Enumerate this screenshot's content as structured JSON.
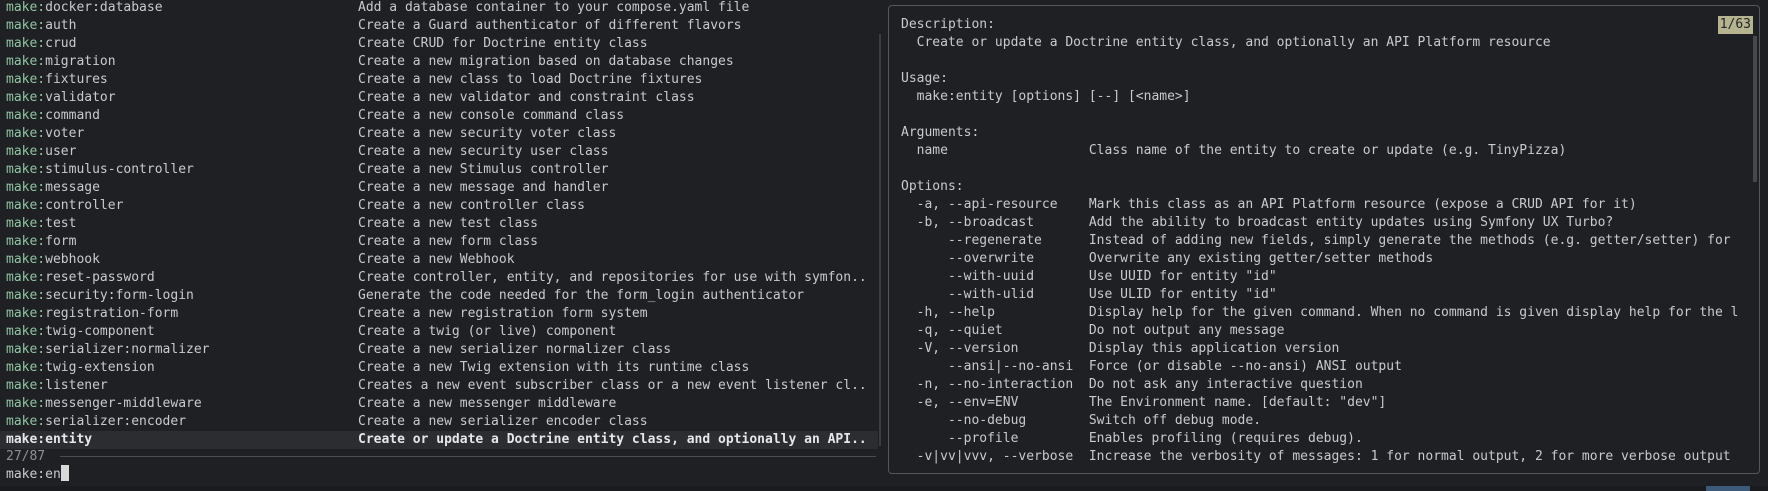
{
  "list": {
    "items": [
      {
        "cmd": "docker:database",
        "desc": "Add a database container to your compose.yaml file"
      },
      {
        "cmd": "auth",
        "desc": "Create a Guard authenticator of different flavors"
      },
      {
        "cmd": "crud",
        "desc": "Create CRUD for Doctrine entity class"
      },
      {
        "cmd": "migration",
        "desc": "Create a new migration based on database changes"
      },
      {
        "cmd": "fixtures",
        "desc": "Create a new class to load Doctrine fixtures"
      },
      {
        "cmd": "validator",
        "desc": "Create a new validator and constraint class"
      },
      {
        "cmd": "command",
        "desc": "Create a new console command class"
      },
      {
        "cmd": "voter",
        "desc": "Create a new security voter class"
      },
      {
        "cmd": "user",
        "desc": "Create a new security user class"
      },
      {
        "cmd": "stimulus-controller",
        "desc": "Create a new Stimulus controller"
      },
      {
        "cmd": "message",
        "desc": "Create a new message and handler"
      },
      {
        "cmd": "controller",
        "desc": "Create a new controller class"
      },
      {
        "cmd": "test",
        "desc": "Create a new test class"
      },
      {
        "cmd": "form",
        "desc": "Create a new form class"
      },
      {
        "cmd": "webhook",
        "desc": "Create a new Webhook"
      },
      {
        "cmd": "reset-password",
        "desc": "Create controller, entity, and repositories for use with symfon.."
      },
      {
        "cmd": "security:form-login",
        "desc": "Generate the code needed for the form_login authenticator"
      },
      {
        "cmd": "registration-form",
        "desc": "Create a new registration form system"
      },
      {
        "cmd": "twig-component",
        "desc": "Create a twig (or live) component"
      },
      {
        "cmd": "serializer:normalizer",
        "desc": "Create a new serializer normalizer class"
      },
      {
        "cmd": "twig-extension",
        "desc": "Create a new Twig extension with its runtime class"
      },
      {
        "cmd": "listener",
        "desc": "Creates a new event subscriber class or a new event listener cl.."
      },
      {
        "cmd": "messenger-middleware",
        "desc": "Create a new messenger middleware"
      },
      {
        "cmd": "serializer:encoder",
        "desc": "Create a new serializer encoder class"
      },
      {
        "cmd": "entity",
        "desc": "Create or update a Doctrine entity class, and optionally an API.."
      }
    ],
    "prefix": "make:",
    "selected_index": 24,
    "count": "27/87"
  },
  "prompt": {
    "value": "make:en"
  },
  "preview": {
    "counter": "1/63",
    "lines": [
      "Description:",
      "  Create or update a Doctrine entity class, and optionally an API Platform resource",
      "",
      "Usage:",
      "  make:entity [options] [--] [<name>]",
      "",
      "Arguments:",
      "  name                  Class name of the entity to create or update (e.g. TinyPizza)",
      "",
      "Options:",
      "  -a, --api-resource    Mark this class as an API Platform resource (expose a CRUD API for it)",
      "  -b, --broadcast       Add the ability to broadcast entity updates using Symfony UX Turbo?",
      "      --regenerate      Instead of adding new fields, simply generate the methods (e.g. getter/setter) for",
      "      --overwrite       Overwrite any existing getter/setter methods",
      "      --with-uuid       Use UUID for entity \"id\"",
      "      --with-ulid       Use ULID for entity \"id\"",
      "  -h, --help            Display help for the given command. When no command is given display help for the l",
      "  -q, --quiet           Do not output any message",
      "  -V, --version         Display this application version",
      "      --ansi|--no-ansi  Force (or disable --no-ansi) ANSI output",
      "  -n, --no-interaction  Do not ask any interactive question",
      "  -e, --env=ENV         The Environment name. [default: \"dev\"]",
      "      --no-debug        Switch off debug mode.",
      "      --profile         Enables profiling (requires debug).",
      "  -v|vv|vvv, --verbose  Increase the verbosity of messages: 1 for normal output, 2 for more verbose output"
    ]
  },
  "colors": {
    "background": "#1f2023",
    "prefix": "#8fc5a2",
    "counter_bg": "#b6b38f",
    "selected_bg": "#2b2d31"
  }
}
